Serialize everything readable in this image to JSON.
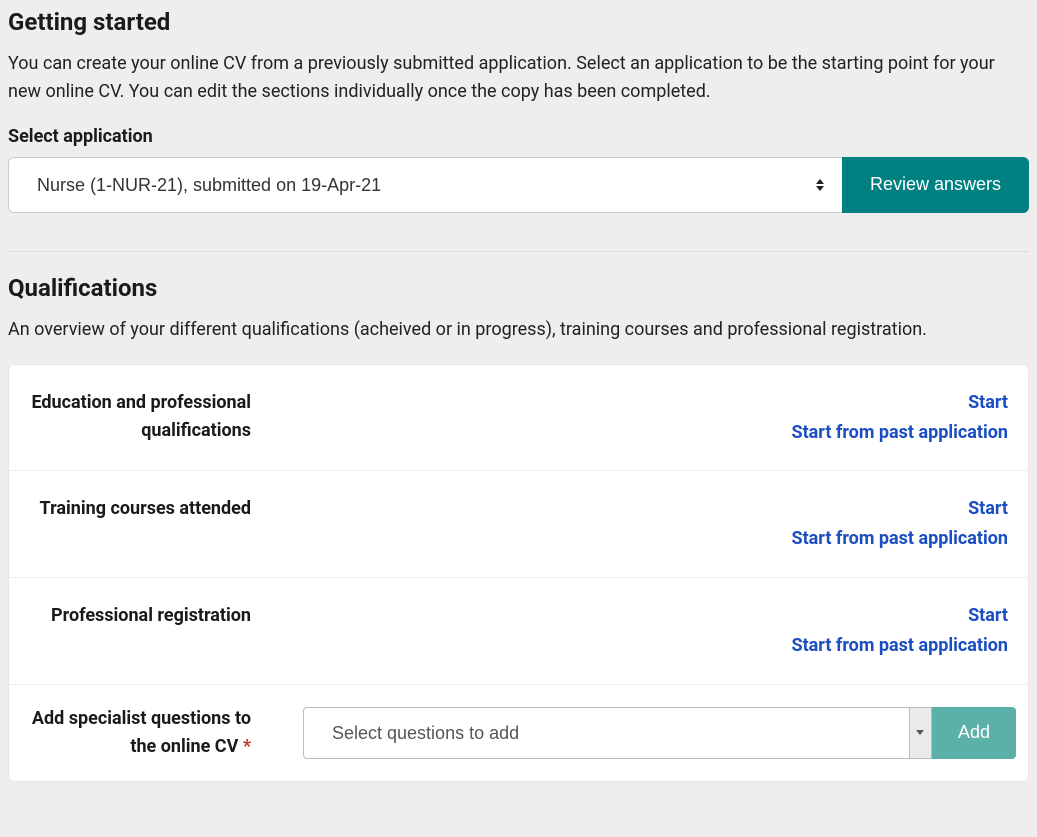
{
  "getting_started": {
    "heading": "Getting started",
    "intro": "You can create your online CV from a previously submitted application. Select an application to be the starting point for your new online CV. You can edit the sections individually once the copy has been completed.",
    "select_label": "Select application",
    "selected_application": "Nurse (1-NUR-21), submitted on 19-Apr-21",
    "review_button": "Review answers"
  },
  "qualifications": {
    "heading": "Qualifications",
    "intro": "An overview of your different qualifications (acheived or in progress), training courses and professional registration.",
    "rows": [
      {
        "label": "Education and professional qualifications",
        "start_label": "Start",
        "past_label": "Start from past application"
      },
      {
        "label": "Training courses attended",
        "start_label": "Start",
        "past_label": "Start from past application"
      },
      {
        "label": "Professional registration",
        "start_label": "Start",
        "past_label": "Start from past application"
      }
    ],
    "add_specialist": {
      "label": "Add specialist questions to the online CV",
      "required_marker": "*",
      "placeholder": "Select questions to add",
      "add_button": "Add"
    }
  }
}
